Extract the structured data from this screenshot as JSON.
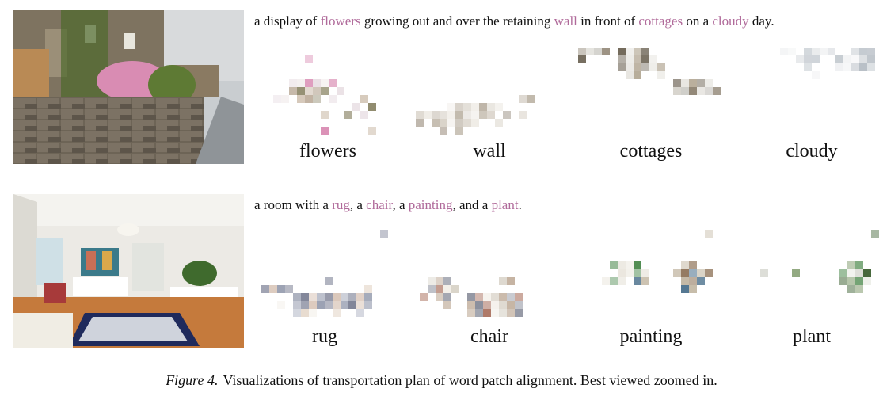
{
  "rows": [
    {
      "caption_parts": [
        "a display of ",
        "flowers",
        " growing out and over the retaining ",
        "wall",
        " in front of ",
        "cottages",
        " on a ",
        "cloudy",
        " day."
      ],
      "words": [
        "flowers",
        "wall",
        "cottages",
        "cloudy"
      ]
    },
    {
      "caption_parts": [
        "a room with a ",
        "rug",
        ", a ",
        "chair",
        ", a ",
        "painting",
        ", and a ",
        "plant",
        "."
      ],
      "words": [
        "rug",
        "chair",
        "painting",
        "plant"
      ]
    }
  ],
  "figure": {
    "label": "Figure 4.",
    "text": "Visualizations of transportation plan of word patch alignment. Best viewed zoomed in."
  }
}
